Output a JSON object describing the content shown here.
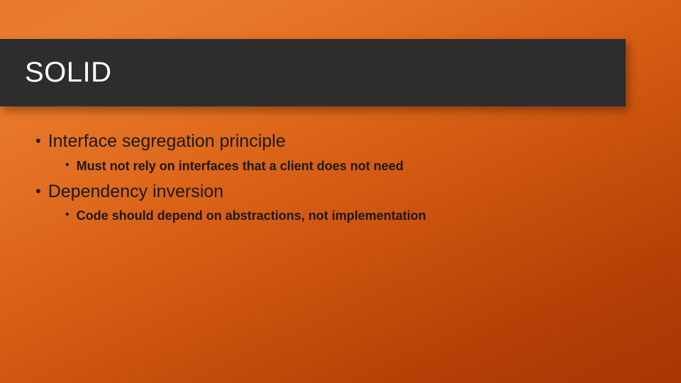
{
  "title": "SOLID",
  "bullets": [
    {
      "level": 1,
      "text": "Interface segregation principle"
    },
    {
      "level": 2,
      "text": "Must not rely on interfaces that a client does not need"
    },
    {
      "level": 1,
      "text": "Dependency inversion"
    },
    {
      "level": 2,
      "text": "Code should depend on abstractions, not implementation"
    }
  ]
}
